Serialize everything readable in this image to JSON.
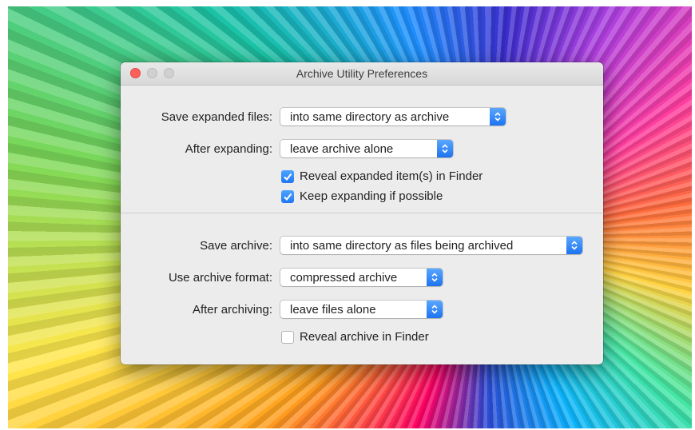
{
  "window": {
    "title": "Archive Utility Preferences"
  },
  "expand": {
    "save_label": "Save expanded files:",
    "save_value": "into same directory as archive",
    "after_label": "After expanding:",
    "after_value": "leave archive alone",
    "reveal_label": "Reveal expanded item(s) in Finder",
    "reveal_checked": true,
    "keep_label": "Keep expanding if possible",
    "keep_checked": true
  },
  "archive": {
    "save_label": "Save archive:",
    "save_value": "into same directory as files being archived",
    "format_label": "Use archive format:",
    "format_value": "compressed archive",
    "after_label": "After archiving:",
    "after_value": "leave files alone",
    "reveal_label": "Reveal archive in Finder",
    "reveal_checked": false
  },
  "icons": {
    "close": "close-icon",
    "minimize": "minimize-icon",
    "zoom": "zoom-icon",
    "popup_arrows": "chevron-updown-icon",
    "checkmark": "checkmark-icon"
  },
  "colors": {
    "accent": "#1e76f2",
    "close_button": "#fc605b",
    "window_bg": "#ececec"
  }
}
